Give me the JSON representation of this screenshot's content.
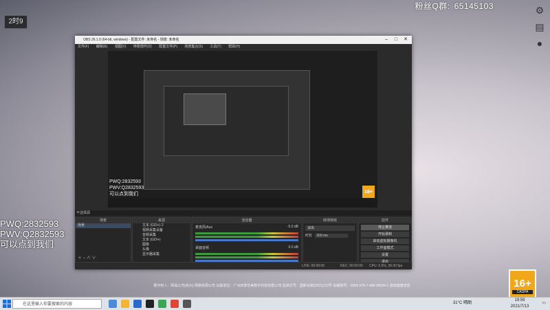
{
  "overlay": {
    "timer_badge": "2时9",
    "fans_label": "粉丝Q群:",
    "fans_number": "65145103",
    "promo_lines": [
      "PWQ:2832593",
      "PWV:Q2832593",
      "可以点到我们"
    ],
    "rating_label": "16+",
    "rating_sub": "CADPA",
    "credits": "著作权人：网易公司(杭州) 网络有限公司 出版单位：广州四季优美数字科技有限公司 批准文号：国新出审[2022]123号 出版物号：ISBN 978-7-498-08184-1 游戏健康忠告"
  },
  "obs": {
    "title": "OBS 26.1.0 (64-bit, windows) - 配置文件: 未命名 - 场景: 未命名",
    "menu": [
      "文件(F)",
      "编辑(E)",
      "视图(V)",
      "停靠部件(D)",
      "配置文件(P)",
      "场景集合(S)",
      "工具(T)",
      "帮助(H)"
    ],
    "preview_promo": [
      "PWQ:2832593",
      "PWV:Q2832593",
      "可以点到我们"
    ],
    "scene_bar": "不选择源",
    "docks": {
      "scenes": {
        "title": "场景",
        "items": [
          "场景"
        ]
      },
      "sources": {
        "title": "来源",
        "items": [
          "文本 (GDI+) 2",
          "视频采集设备",
          "音频采集",
          "文本 (GDI+)",
          "图像",
          "头像",
          "显示器采集"
        ]
      },
      "mixer": {
        "title": "混音器",
        "tracks": [
          {
            "name": "麦克风/Aux",
            "db": "-5.0 dB"
          },
          {
            "name": "桌面音频",
            "db": "0.0 dB"
          }
        ]
      },
      "transitions": {
        "title": "转场特效",
        "type": "淡出",
        "duration_label": "时长",
        "duration": "300 ms"
      },
      "controls": {
        "title": "控件",
        "buttons": [
          "停止推流",
          "开始录制",
          "启动虚拟摄像机",
          "工作室模式",
          "设置",
          "退出"
        ]
      }
    },
    "status": {
      "live": "LIVE: 00:00:00",
      "rec": "REC: 00:00:00",
      "cpu": "CPU: 6.5%, 30.00 fps"
    }
  },
  "taskbar": {
    "search_placeholder": "在这里输入你要搜索的内容",
    "weather": "31°C 晴朗",
    "time": "19:59",
    "date": "2021/7/13"
  },
  "colors": {
    "rating": "#f0a81a",
    "obs_bg": "#2b2b2b",
    "selected": "#3b4a63"
  }
}
